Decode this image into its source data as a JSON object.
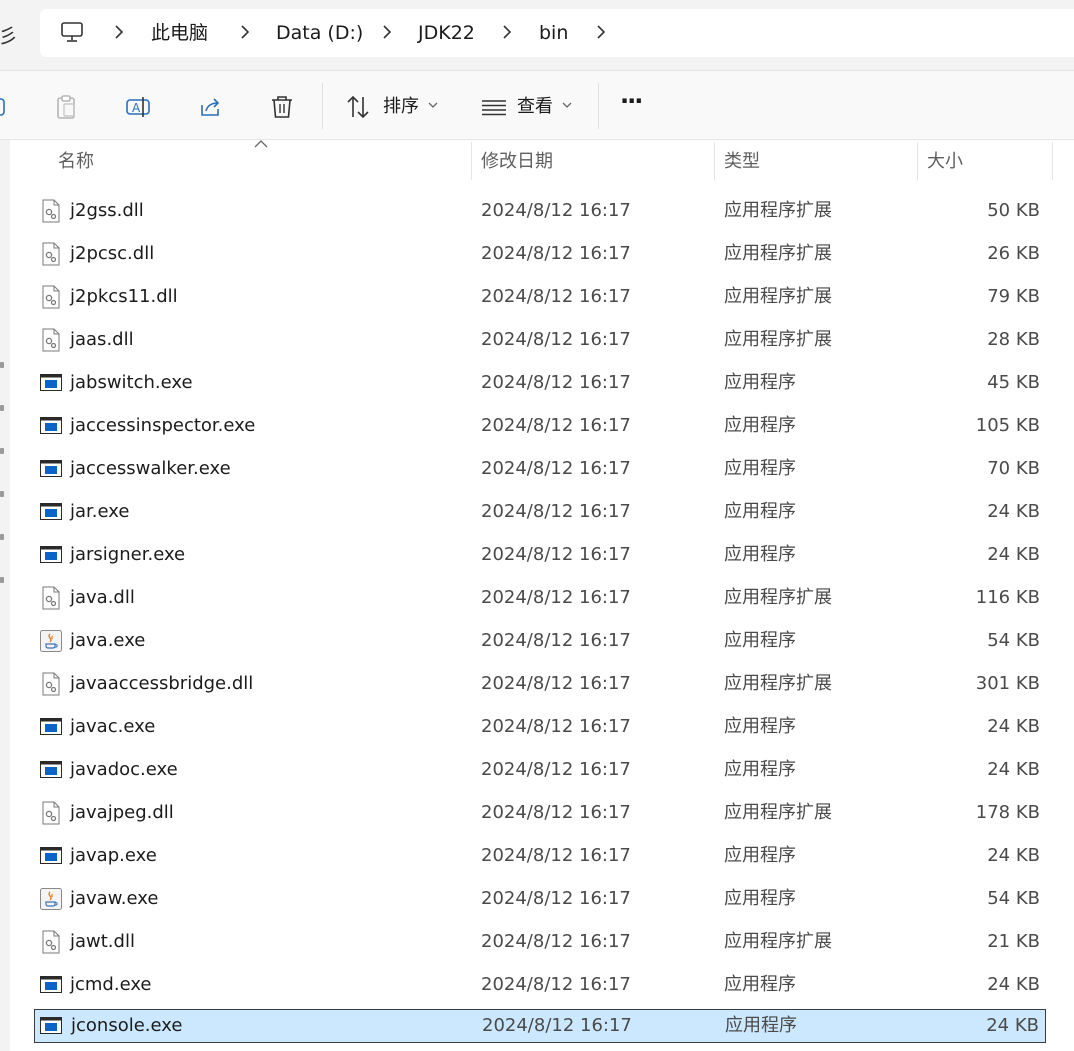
{
  "address": {
    "left_glyph": "彡",
    "icon": "computer-icon",
    "crumbs": [
      "此电脑",
      "Data (D:)",
      "JDK22",
      "bin"
    ]
  },
  "toolbar": {
    "sort_label": "排序",
    "view_label": "查看",
    "more_label": "···",
    "icons": [
      "copy-icon",
      "paste-icon",
      "rename-icon",
      "share-icon",
      "delete-icon",
      "sort-icon",
      "view-icon"
    ]
  },
  "columns": {
    "name": "名称",
    "date": "修改日期",
    "type": "类型",
    "size": "大小"
  },
  "colors": {
    "selection_bg": "#cce8ff",
    "exe_blue": "#0a64c8"
  },
  "files": [
    {
      "name": "j2gss.dll",
      "date": "2024/8/12 16:17",
      "type": "应用程序扩展",
      "size": "50 KB",
      "icon": "dll"
    },
    {
      "name": "j2pcsc.dll",
      "date": "2024/8/12 16:17",
      "type": "应用程序扩展",
      "size": "26 KB",
      "icon": "dll"
    },
    {
      "name": "j2pkcs11.dll",
      "date": "2024/8/12 16:17",
      "type": "应用程序扩展",
      "size": "79 KB",
      "icon": "dll"
    },
    {
      "name": "jaas.dll",
      "date": "2024/8/12 16:17",
      "type": "应用程序扩展",
      "size": "28 KB",
      "icon": "dll"
    },
    {
      "name": "jabswitch.exe",
      "date": "2024/8/12 16:17",
      "type": "应用程序",
      "size": "45 KB",
      "icon": "exe"
    },
    {
      "name": "jaccessinspector.exe",
      "date": "2024/8/12 16:17",
      "type": "应用程序",
      "size": "105 KB",
      "icon": "exe"
    },
    {
      "name": "jaccesswalker.exe",
      "date": "2024/8/12 16:17",
      "type": "应用程序",
      "size": "70 KB",
      "icon": "exe"
    },
    {
      "name": "jar.exe",
      "date": "2024/8/12 16:17",
      "type": "应用程序",
      "size": "24 KB",
      "icon": "exe"
    },
    {
      "name": "jarsigner.exe",
      "date": "2024/8/12 16:17",
      "type": "应用程序",
      "size": "24 KB",
      "icon": "exe"
    },
    {
      "name": "java.dll",
      "date": "2024/8/12 16:17",
      "type": "应用程序扩展",
      "size": "116 KB",
      "icon": "dll"
    },
    {
      "name": "java.exe",
      "date": "2024/8/12 16:17",
      "type": "应用程序",
      "size": "54 KB",
      "icon": "java"
    },
    {
      "name": "javaaccessbridge.dll",
      "date": "2024/8/12 16:17",
      "type": "应用程序扩展",
      "size": "301 KB",
      "icon": "dll"
    },
    {
      "name": "javac.exe",
      "date": "2024/8/12 16:17",
      "type": "应用程序",
      "size": "24 KB",
      "icon": "exe"
    },
    {
      "name": "javadoc.exe",
      "date": "2024/8/12 16:17",
      "type": "应用程序",
      "size": "24 KB",
      "icon": "exe"
    },
    {
      "name": "javajpeg.dll",
      "date": "2024/8/12 16:17",
      "type": "应用程序扩展",
      "size": "178 KB",
      "icon": "dll"
    },
    {
      "name": "javap.exe",
      "date": "2024/8/12 16:17",
      "type": "应用程序",
      "size": "24 KB",
      "icon": "exe"
    },
    {
      "name": "javaw.exe",
      "date": "2024/8/12 16:17",
      "type": "应用程序",
      "size": "54 KB",
      "icon": "java"
    },
    {
      "name": "jawt.dll",
      "date": "2024/8/12 16:17",
      "type": "应用程序扩展",
      "size": "21 KB",
      "icon": "dll"
    },
    {
      "name": "jcmd.exe",
      "date": "2024/8/12 16:17",
      "type": "应用程序",
      "size": "24 KB",
      "icon": "exe"
    },
    {
      "name": "jconsole.exe",
      "date": "2024/8/12 16:17",
      "type": "应用程序",
      "size": "24 KB",
      "icon": "exe",
      "selected": true
    }
  ]
}
